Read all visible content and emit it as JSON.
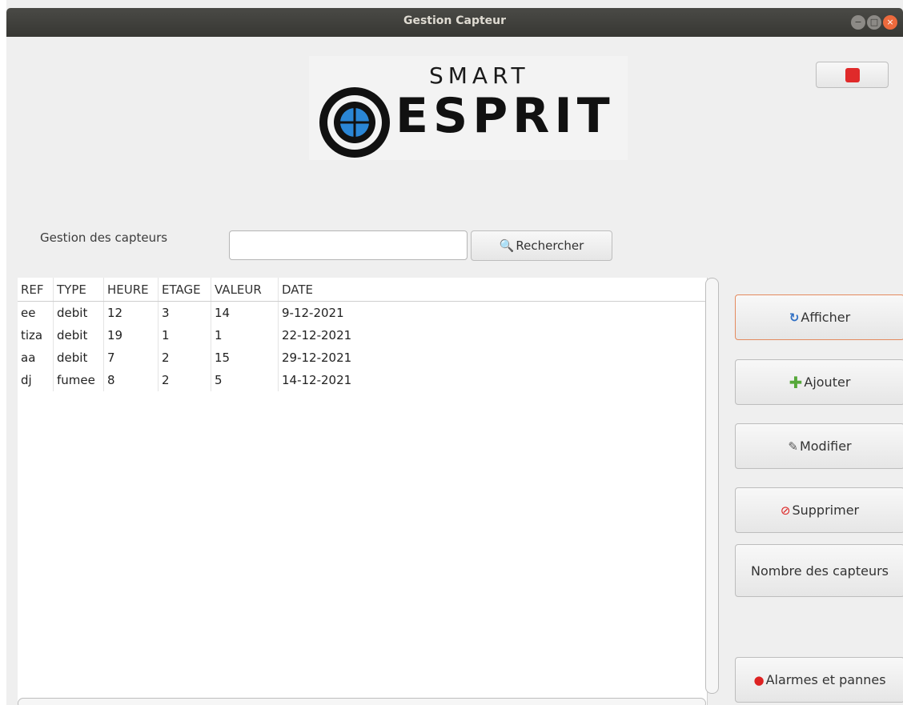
{
  "window": {
    "title": "Gestion Capteur",
    "buttons": {
      "minimize": "−",
      "maximize": "□",
      "close": "×"
    }
  },
  "logo": {
    "line1": "SMART",
    "line2": "ESPRIT"
  },
  "colors": {
    "accent": "#e48a5e",
    "power": "#e02a2a",
    "title_bg": "#3c3b37"
  },
  "icons": {
    "power": "power-icon",
    "search": "magnifier-icon",
    "refresh": "refresh-icon",
    "add": "plus-icon",
    "edit": "pencil-icon",
    "delete": "no-entry-icon",
    "alarm": "alert-icon"
  },
  "search": {
    "section_label": "Gestion des capteurs",
    "value": "",
    "button_label": "Rechercher"
  },
  "table": {
    "columns": [
      "REF",
      "TYPE",
      "HEURE",
      "ETAGE",
      "VALEUR",
      "DATE"
    ],
    "rows": [
      [
        "ee",
        "debit",
        "12",
        "3",
        "14",
        "9-12-2021"
      ],
      [
        "tiza",
        "debit",
        "19",
        "1",
        "1",
        "22-12-2021"
      ],
      [
        "aa",
        "debit",
        "7",
        "2",
        "15",
        "29-12-2021"
      ],
      [
        "dj",
        "fumee",
        "8",
        "2",
        "5",
        "14-12-2021"
      ]
    ]
  },
  "actions": {
    "afficher": "Afficher",
    "ajouter": "Ajouter",
    "modifier": "Modifier",
    "supprimer": "Supprimer",
    "nombre": "Nombre des capteurs",
    "alarmes": "Alarmes et pannes"
  }
}
